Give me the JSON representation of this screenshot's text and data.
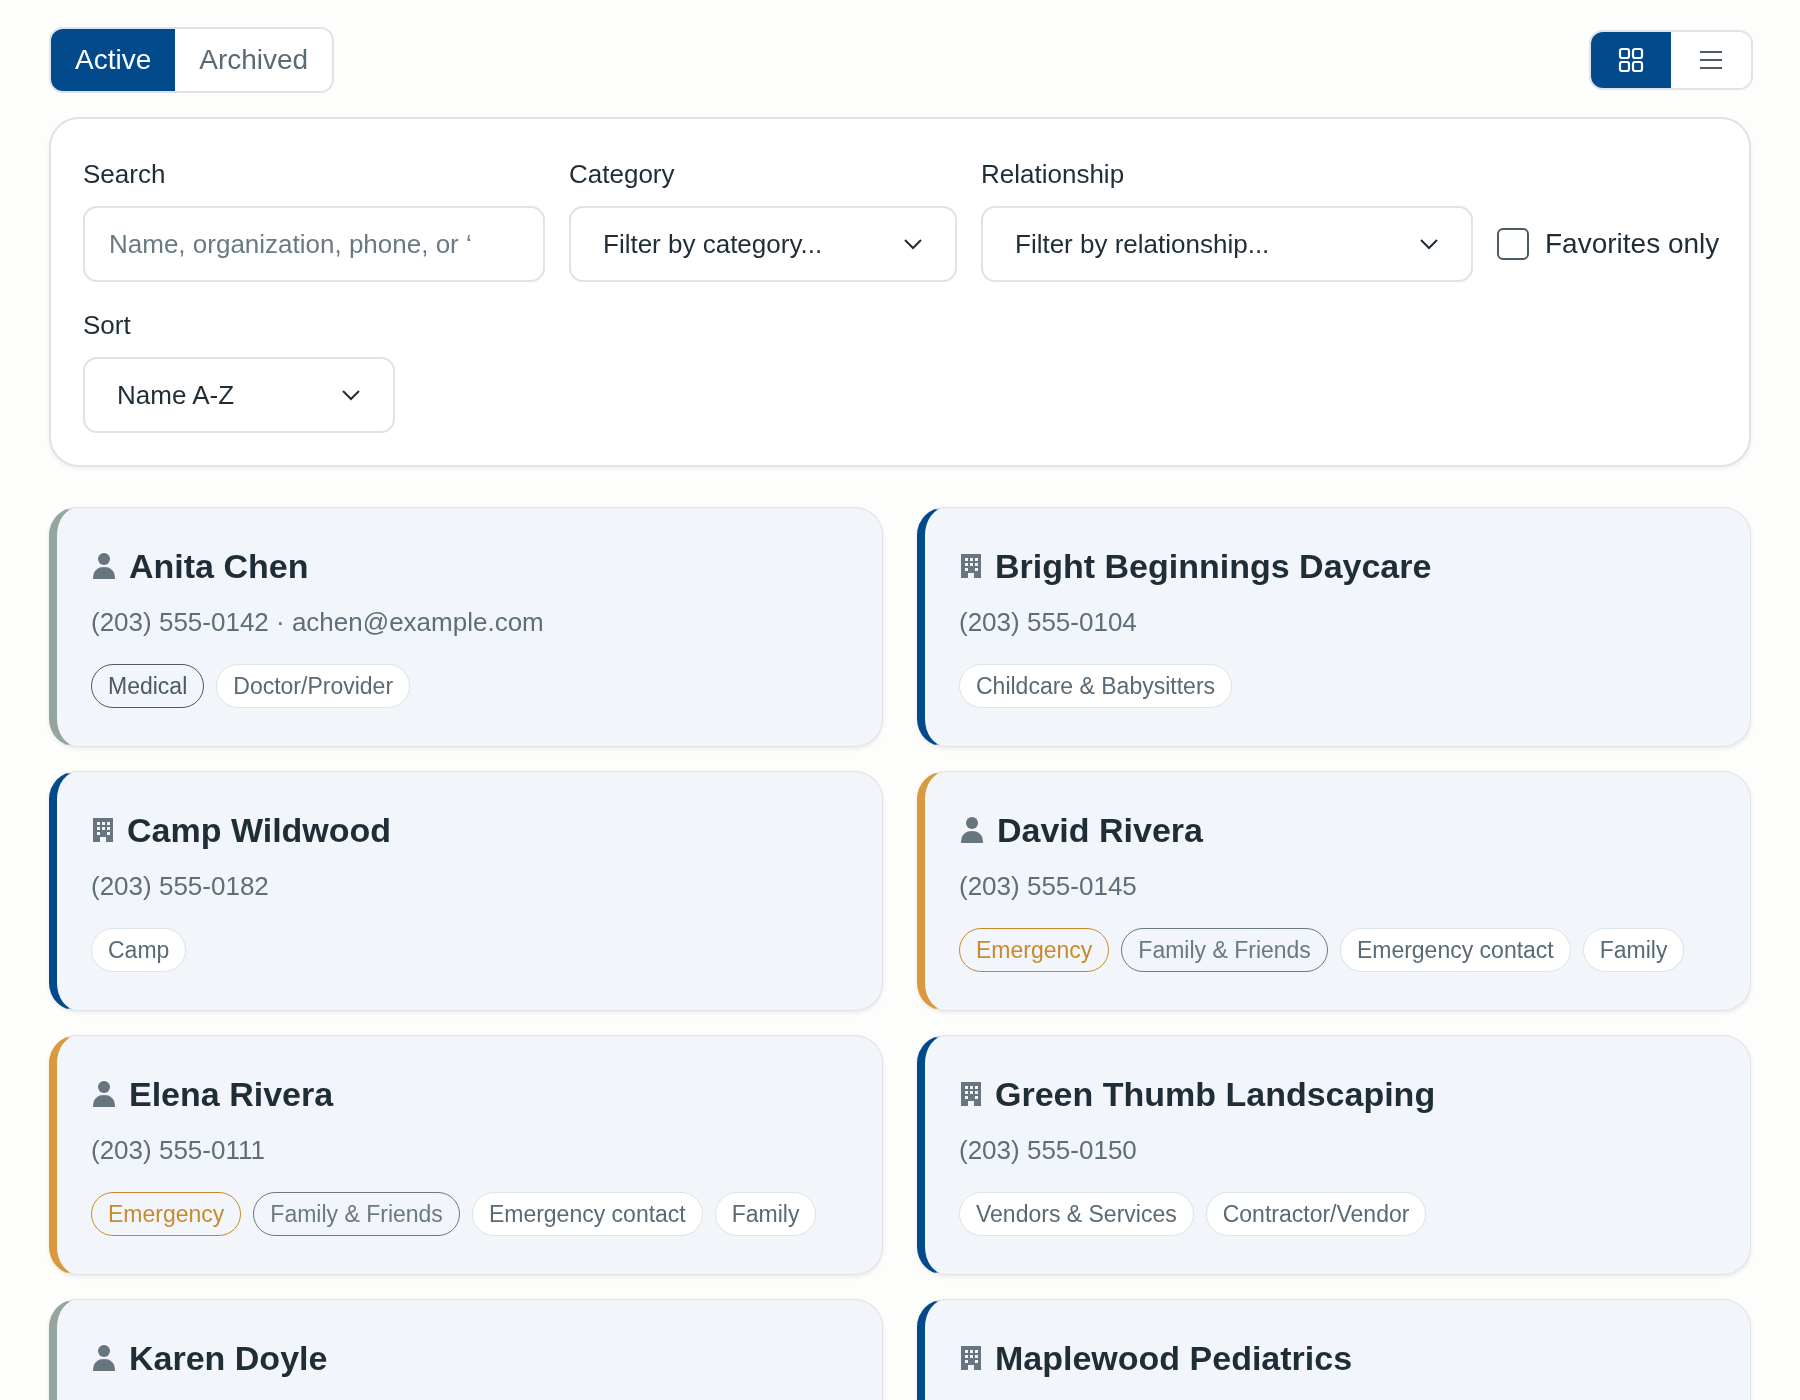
{
  "status_tabs": [
    {
      "label": "Active",
      "selected": true
    },
    {
      "label": "Archived",
      "selected": false
    }
  ],
  "view_toggle": [
    {
      "kind": "grid",
      "selected": true
    },
    {
      "kind": "list",
      "selected": false
    }
  ],
  "filters": {
    "search": {
      "label": "Search",
      "placeholder": "Name, organization, phone, or ‘"
    },
    "category": {
      "label": "Category",
      "value": "Filter by category..."
    },
    "relationship": {
      "label": "Relationship",
      "value": "Filter by relationship..."
    },
    "favorites_only": {
      "label": "Favorites only",
      "checked": false
    },
    "sort": {
      "label": "Sort",
      "value": "Name A-Z"
    }
  },
  "contacts": [
    {
      "kind": "person",
      "name": "Anita Chen",
      "details": "(203) 555-0142 · achen@example.com",
      "color": "#94a59f",
      "tags": [
        {
          "label": "Medical",
          "color": "#4b5a63"
        },
        {
          "label": "Doctor/Provider"
        }
      ]
    },
    {
      "kind": "organization",
      "name": "Bright Beginnings Daycare",
      "details": "(203) 555-0104",
      "color": "#034a8c",
      "tags": [
        {
          "label": "Childcare & Babysitters"
        }
      ]
    },
    {
      "kind": "organization",
      "name": "Camp Wildwood",
      "details": "(203) 555-0182",
      "color": "#034a8c",
      "tags": [
        {
          "label": "Camp"
        }
      ]
    },
    {
      "kind": "person",
      "name": "David Rivera",
      "details": "(203) 555-0145",
      "color": "#d99a3e",
      "tags": [
        {
          "label": "Emergency",
          "color": "#c98a2e"
        },
        {
          "label": "Family & Friends",
          "color": "#6b7a82"
        },
        {
          "label": "Emergency contact"
        },
        {
          "label": "Family"
        }
      ]
    },
    {
      "kind": "person",
      "name": "Elena Rivera",
      "details": "(203) 555-0111",
      "color": "#d99a3e",
      "tags": [
        {
          "label": "Emergency",
          "color": "#c98a2e"
        },
        {
          "label": "Family & Friends",
          "color": "#6b7a82"
        },
        {
          "label": "Emergency contact"
        },
        {
          "label": "Family"
        }
      ]
    },
    {
      "kind": "organization",
      "name": "Green Thumb Landscaping",
      "details": "(203) 555-0150",
      "color": "#034a8c",
      "tags": [
        {
          "label": "Vendors & Services"
        },
        {
          "label": "Contractor/Vendor"
        }
      ]
    },
    {
      "kind": "person",
      "name": "Karen Doyle",
      "color": "#94a59f"
    },
    {
      "kind": "organization",
      "name": "Maplewood Pediatrics",
      "color": "#034a8c"
    }
  ]
}
